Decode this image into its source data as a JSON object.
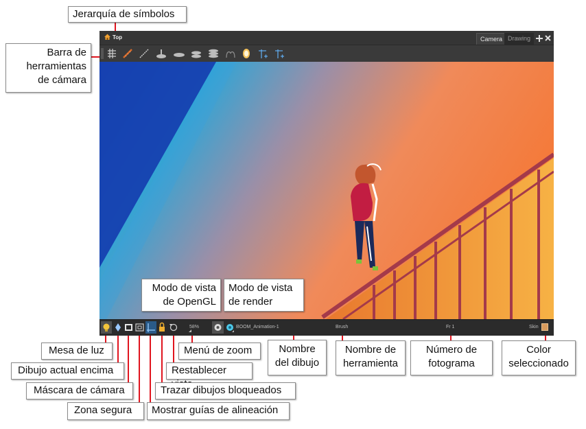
{
  "window": {
    "breadcrumb": "Top",
    "tabs": [
      "Camera",
      "Drawing"
    ],
    "add_icon": "plus-icon",
    "close_icon": "close-icon"
  },
  "toolbar_icons": [
    "grid-icon",
    "ruler-icon",
    "line-icon",
    "turnip-icon",
    "ellipse-icon",
    "cylinder-icon",
    "stack-icon",
    "pegs-icon",
    "clock-icon",
    "plus-axis-icon",
    "axis-icon"
  ],
  "status": {
    "zoom": "58%",
    "drawing_name": "BOOM_Animation-1",
    "tool_name": "Brush",
    "frame": "Fr 1",
    "color_label": "Skin",
    "selected_color": "#d89a5c"
  },
  "callouts": {
    "symbol_hierarchy": "Jerarquía de símbolos",
    "camera_toolbar_1": "Barra de",
    "camera_toolbar_2": "herramientas",
    "camera_toolbar_3": "de cámara",
    "opengl_mode_1": "Modo de vista",
    "opengl_mode_2": "de OpenGL",
    "render_mode_1": "Modo de vista",
    "render_mode_2": "de render",
    "light_table": "Mesa de luz",
    "current_on_top": "Dibujo actual encima",
    "camera_mask": "Máscara de cámara",
    "safe_area": "Zona segura",
    "zoom_menu": "Menú de zoom",
    "reset_view": "Restablecer vista",
    "trace_locked": "Trazar dibujos bloqueados",
    "show_guides": "Mostrar guías de alineación",
    "drawing_name_1": "Nombre",
    "drawing_name_2": "del dibujo",
    "tool_name_1": "Nombre de",
    "tool_name_2": "herramienta",
    "frame_number_1": "Número de",
    "frame_number_2": "fotograma",
    "selected_color_1": "Color",
    "selected_color_2": "seleccionado"
  }
}
